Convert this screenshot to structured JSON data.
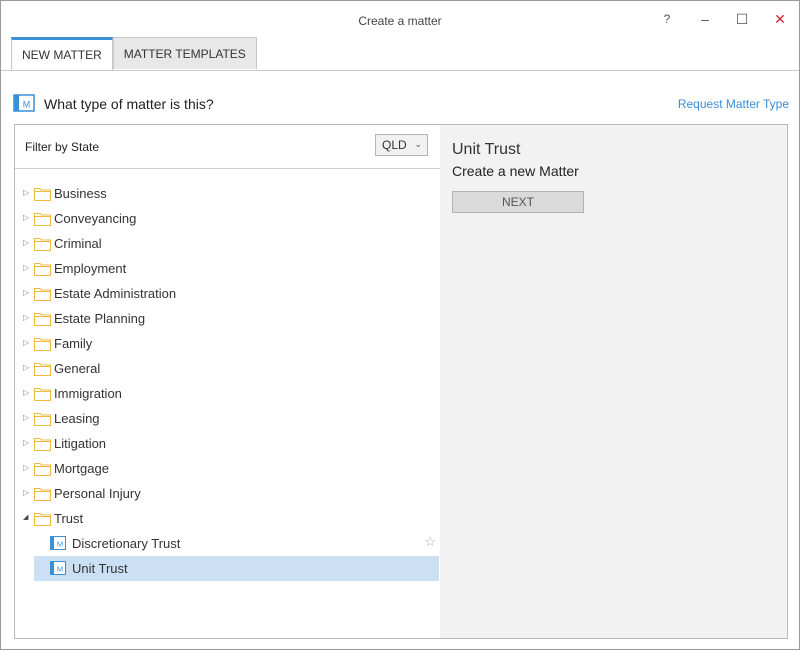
{
  "window": {
    "title": "Create a matter",
    "help_label": "?",
    "minimize_label": "–",
    "maximize_label": "☐",
    "close_label": "✕",
    "close_color": "#d6262f"
  },
  "tabs": [
    {
      "label": "NEW MATTER",
      "active": true
    },
    {
      "label": "MATTER TEMPLATES",
      "active": false
    }
  ],
  "header": {
    "question": "What type of matter is this?",
    "request_link": "Request Matter Type",
    "icon": "matter-icon"
  },
  "filter": {
    "label": "Filter by State",
    "selected_state": "QLD",
    "chevron": "⌄"
  },
  "tree": {
    "categories": [
      {
        "label": "Business",
        "expanded": false
      },
      {
        "label": "Conveyancing",
        "expanded": false
      },
      {
        "label": "Criminal",
        "expanded": false
      },
      {
        "label": "Employment",
        "expanded": false
      },
      {
        "label": "Estate Administration",
        "expanded": false
      },
      {
        "label": "Estate Planning",
        "expanded": false
      },
      {
        "label": "Family",
        "expanded": false
      },
      {
        "label": "General",
        "expanded": false
      },
      {
        "label": "Immigration",
        "expanded": false
      },
      {
        "label": "Leasing",
        "expanded": false
      },
      {
        "label": "Litigation",
        "expanded": false
      },
      {
        "label": "Mortgage",
        "expanded": false
      },
      {
        "label": "Personal Injury",
        "expanded": false
      },
      {
        "label": "Trust",
        "expanded": true
      }
    ],
    "trust_children": [
      {
        "label": "Discretionary Trust",
        "selected": false
      },
      {
        "label": "Unit Trust",
        "selected": true
      }
    ]
  },
  "detail": {
    "title": "Unit Trust",
    "subtitle": "Create a new Matter",
    "next_label": "NEXT"
  },
  "colors": {
    "accent": "#3a8fd6",
    "folder": "#f0b840",
    "selection": "#cce0f5"
  }
}
